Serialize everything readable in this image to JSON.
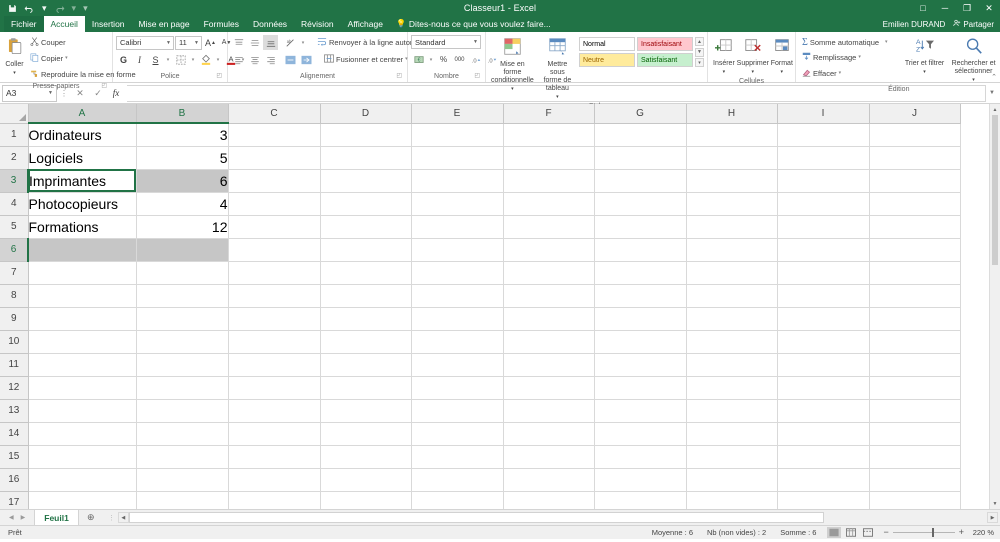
{
  "window": {
    "title": "Classeur1 - Excel",
    "quick_access": [
      "save-icon",
      "undo-icon",
      "redo-icon",
      "customize-icon"
    ],
    "controls": {
      "ribbon_display": "□",
      "minimize": "─",
      "restore": "❐",
      "close": "✕"
    }
  },
  "account": {
    "user": "Emilien DURAND",
    "share_label": "Partager"
  },
  "tabs": [
    {
      "label": "Fichier",
      "active": false,
      "file": true
    },
    {
      "label": "Accueil",
      "active": true,
      "file": false
    },
    {
      "label": "Insertion",
      "active": false,
      "file": false
    },
    {
      "label": "Mise en page",
      "active": false,
      "file": false
    },
    {
      "label": "Formules",
      "active": false,
      "file": false
    },
    {
      "label": "Données",
      "active": false,
      "file": false
    },
    {
      "label": "Révision",
      "active": false,
      "file": false
    },
    {
      "label": "Affichage",
      "active": false,
      "file": false
    }
  ],
  "tell_me": "Dites-nous ce que vous voulez faire...",
  "ribbon": {
    "clipboard": {
      "label": "Presse-papiers",
      "paste": "Coller",
      "cut": "Couper",
      "copy": "Copier",
      "format_painter": "Reproduire la mise en forme"
    },
    "font": {
      "label": "Police",
      "font_name": "Calibri",
      "font_size": "11",
      "grow": "A",
      "shrink": "A",
      "bold": "G",
      "italic": "I",
      "underline": "S",
      "borders": "borders-icon",
      "fill_color": "fill-color-icon",
      "font_color": "A"
    },
    "alignment": {
      "label": "Alignement",
      "wrap_text": "Renvoyer à la ligne automatiquement",
      "merge_center": "Fusionner et centrer"
    },
    "number": {
      "label": "Nombre",
      "format": "Standard",
      "accounting": "accounting-icon",
      "percent": "%",
      "thousands": "000",
      "increase_decimal": "increase-decimal-icon",
      "decrease_decimal": "decrease-decimal-icon"
    },
    "styles": {
      "label": "Style",
      "conditional": "Mise en forme conditionnelle",
      "table": "Mettre sous forme de tableau",
      "gallery": [
        {
          "name": "Normal",
          "bg": "#ffffff",
          "fg": "#000000"
        },
        {
          "name": "Insatisfaisant",
          "bg": "#ffc7ce",
          "fg": "#9c0006"
        },
        {
          "name": "Neutre",
          "bg": "#ffeb9c",
          "fg": "#9c6500"
        },
        {
          "name": "Satisfaisant",
          "bg": "#c6efce",
          "fg": "#006100"
        }
      ]
    },
    "cells": {
      "label": "Cellules",
      "insert": "Insérer",
      "delete": "Supprimer",
      "format": "Format"
    },
    "editing": {
      "label": "Édition",
      "autosum": "Somme automatique",
      "fill": "Remplissage",
      "clear": "Effacer",
      "sort_filter": "Trier et filtrer",
      "find_select": "Rechercher et sélectionner"
    },
    "collapse": "collapse-ribbon-icon"
  },
  "formula_bar": {
    "name_box": "A3",
    "cancel": "✕",
    "confirm": "✓",
    "fx": "fx",
    "value": "",
    "placeholder": ""
  },
  "grid": {
    "columns": [
      {
        "label": "A",
        "width": 108,
        "selected": true
      },
      {
        "label": "B",
        "width": 92,
        "selected": true
      },
      {
        "label": "C",
        "width": 92,
        "selected": false
      },
      {
        "label": "D",
        "width": 91,
        "selected": false
      },
      {
        "label": "E",
        "width": 92,
        "selected": false
      },
      {
        "label": "F",
        "width": 91,
        "selected": false
      },
      {
        "label": "G",
        "width": 92,
        "selected": false
      },
      {
        "label": "H",
        "width": 91,
        "selected": false
      },
      {
        "label": "I",
        "width": 92,
        "selected": false
      },
      {
        "label": "J",
        "width": 91,
        "selected": false
      }
    ],
    "rows": [
      {
        "num": "1",
        "selected": false,
        "cells": [
          {
            "v": "Ordinateurs",
            "align": "left",
            "state": ""
          },
          {
            "v": "3",
            "align": "right",
            "state": ""
          }
        ]
      },
      {
        "num": "2",
        "selected": false,
        "cells": [
          {
            "v": "Logiciels",
            "align": "left",
            "state": ""
          },
          {
            "v": "5",
            "align": "right",
            "state": ""
          }
        ]
      },
      {
        "num": "3",
        "selected": true,
        "cells": [
          {
            "v": "Imprimantes",
            "align": "left",
            "state": "active"
          },
          {
            "v": "6",
            "align": "right",
            "state": "selected"
          }
        ]
      },
      {
        "num": "4",
        "selected": false,
        "cells": [
          {
            "v": "Photocopieurs",
            "align": "left",
            "state": ""
          },
          {
            "v": "4",
            "align": "right",
            "state": ""
          }
        ]
      },
      {
        "num": "5",
        "selected": false,
        "cells": [
          {
            "v": "Formations",
            "align": "left",
            "state": ""
          },
          {
            "v": "12",
            "align": "right",
            "state": ""
          }
        ]
      },
      {
        "num": "6",
        "selected": true,
        "cells": [
          {
            "v": "",
            "align": "left",
            "state": "selected"
          },
          {
            "v": "",
            "align": "right",
            "state": "selected"
          }
        ]
      },
      {
        "num": "7",
        "selected": false,
        "cells": [
          {
            "v": "",
            "align": "left",
            "state": ""
          },
          {
            "v": "",
            "align": "right",
            "state": ""
          }
        ]
      },
      {
        "num": "8",
        "selected": false,
        "cells": [
          {
            "v": "",
            "align": "left",
            "state": ""
          },
          {
            "v": "",
            "align": "right",
            "state": ""
          }
        ]
      },
      {
        "num": "9",
        "selected": false,
        "cells": [
          {
            "v": "",
            "align": "left",
            "state": ""
          },
          {
            "v": "",
            "align": "right",
            "state": ""
          }
        ]
      },
      {
        "num": "10",
        "selected": false,
        "cells": [
          {
            "v": "",
            "align": "left",
            "state": ""
          },
          {
            "v": "",
            "align": "right",
            "state": ""
          }
        ]
      },
      {
        "num": "11",
        "selected": false,
        "cells": [
          {
            "v": "",
            "align": "left",
            "state": ""
          },
          {
            "v": "",
            "align": "right",
            "state": ""
          }
        ]
      },
      {
        "num": "12",
        "selected": false,
        "cells": [
          {
            "v": "",
            "align": "left",
            "state": ""
          },
          {
            "v": "",
            "align": "right",
            "state": ""
          }
        ]
      },
      {
        "num": "13",
        "selected": false,
        "cells": [
          {
            "v": "",
            "align": "left",
            "state": ""
          },
          {
            "v": "",
            "align": "right",
            "state": ""
          }
        ]
      },
      {
        "num": "14",
        "selected": false,
        "cells": [
          {
            "v": "",
            "align": "left",
            "state": ""
          },
          {
            "v": "",
            "align": "right",
            "state": ""
          }
        ]
      },
      {
        "num": "15",
        "selected": false,
        "cells": [
          {
            "v": "",
            "align": "left",
            "state": ""
          },
          {
            "v": "",
            "align": "right",
            "state": ""
          }
        ]
      },
      {
        "num": "16",
        "selected": false,
        "cells": [
          {
            "v": "",
            "align": "left",
            "state": ""
          },
          {
            "v": "",
            "align": "right",
            "state": ""
          }
        ]
      },
      {
        "num": "17",
        "selected": false,
        "cells": [
          {
            "v": "",
            "align": "left",
            "state": ""
          },
          {
            "v": "",
            "align": "right",
            "state": ""
          }
        ]
      }
    ]
  },
  "sheets": {
    "tabs": [
      "Feuil1"
    ],
    "active": "Feuil1",
    "add_label": "⊕"
  },
  "status": {
    "mode": "Prêt",
    "stats": [
      {
        "label": "Moyenne : 6"
      },
      {
        "label": "Nb (non vides) : 2"
      },
      {
        "label": "Somme : 6"
      }
    ],
    "views": [
      "normal-view-icon",
      "page-layout-icon",
      "page-break-icon"
    ],
    "active_view": "normal-view-icon",
    "zoom_out": "−",
    "zoom_in": "+",
    "zoom_level": "220 %"
  },
  "colors": {
    "brand": "#217346",
    "selection": "#c6c6c6",
    "header": "#f0f0f0"
  }
}
